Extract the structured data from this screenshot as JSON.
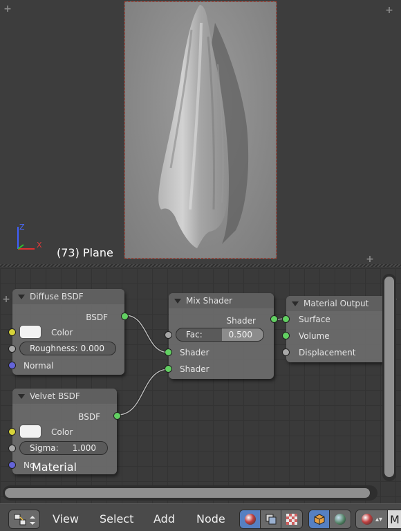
{
  "viewport": {
    "frame_label": "(73) Plane",
    "axis_labels": {
      "z": "Z",
      "x": "X"
    }
  },
  "nodes": {
    "diffuse": {
      "title": "Diffuse BSDF",
      "output": "BSDF",
      "color_label": "Color",
      "roughness_label": "Roughness:",
      "roughness_value": "0.000",
      "normal_label": "Normal"
    },
    "velvet": {
      "title": "Velvet BSDF",
      "output": "BSDF",
      "color_label": "Color",
      "sigma_label": "Sigma:",
      "sigma_value": "1.000",
      "normal_label": "No"
    },
    "mix": {
      "title": "Mix Shader",
      "output": "Shader",
      "fac_label": "Fac:",
      "fac_value": "0.500",
      "fac_fraction": 0.5,
      "input1": "Shader",
      "input2": "Shader"
    },
    "output": {
      "title": "Material Output",
      "surface": "Surface",
      "volume": "Volume",
      "displacement": "Displacement"
    }
  },
  "node_editor": {
    "material_label": "Material"
  },
  "header": {
    "menus": [
      "View",
      "Select",
      "Add",
      "Node"
    ],
    "truncated_label": "M"
  },
  "colors": {
    "socket_shader": "#62d062",
    "socket_color": "#d8d43a",
    "socket_value": "#a8a8a8",
    "socket_vector": "#6464d8",
    "active_button": "#5680c2"
  }
}
